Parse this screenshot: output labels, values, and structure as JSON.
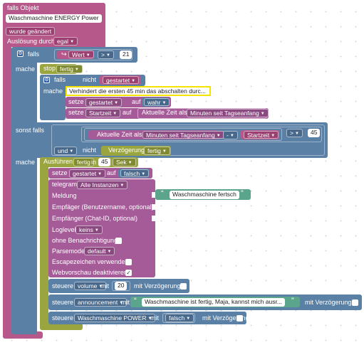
{
  "colors": {
    "event": "#b6598a",
    "logic": "#5b80a5",
    "timeout": "#9aa53f",
    "action": "#a55b98",
    "text": "#5ba58c",
    "comment_border": "#f5e400"
  },
  "trigger": {
    "title": "falls Objekt",
    "object": "Waschmaschine ENERGY Power",
    "condition": "wurde geändert",
    "ack_label": "Auslösung durch",
    "ack_value": "egal"
  },
  "if_outer": {
    "falls": "falls",
    "mache": "mache",
    "sonst_falls": "sonst falls",
    "mache2": "mache",
    "cond": {
      "fn_icon": "↪",
      "fn_value": "Wert",
      "op": ">",
      "num": "21"
    }
  },
  "stop": {
    "label": "stop",
    "value": "fertig"
  },
  "if_inner": {
    "falls": "falls",
    "not": "nicht",
    "var": "gestartet",
    "mache": "mache",
    "comment": "Verhindert die ersten 45 min das abschalten durc...",
    "set1": {
      "setze": "setze",
      "var": "gestartet",
      "auf": "auf",
      "value": "wahr"
    },
    "set2": {
      "setze": "setze",
      "var": "Startzeit",
      "auf": "auf",
      "time_label": "Aktuelle Zeit als",
      "time_format": "Minuten seit Tagseanfang"
    }
  },
  "elseif_cond": {
    "time_label": "Aktuelle Zeit als",
    "time_format": "Minuten seit Tagseanfang",
    "minus": "-",
    "var": "Startzeit",
    "op": ">",
    "num": "45",
    "and": "und",
    "not": "nicht",
    "timeout_label": "Verzögerung",
    "timeout_value": "fertig"
  },
  "timeout": {
    "label": "Ausführen",
    "name": "fertig",
    "in": "in",
    "delay": "45",
    "unit": "Sek"
  },
  "set3": {
    "setze": "setze",
    "var": "gestartet",
    "auf": "auf",
    "value": "falsch"
  },
  "telegram": {
    "label": "telegram",
    "instance": "Alle Instanzen",
    "meldung": "Meldung",
    "message": "Waschmaschine fertsch",
    "empfaenger_name": "Empfäger (Benutzername, optional)",
    "empfaenger_chat": "Empfänger (Chat-ID, optional)",
    "loglevel_label": "Loglevel",
    "loglevel_value": "keins",
    "no_notification": "ohne Benachrichtigung",
    "parsemode_label": "Parsemode",
    "parsemode_value": "default",
    "escape": "Escapezeichen verwenden",
    "webpreview": "Webvorschau deaktivieren",
    "webpreview_check": "✓"
  },
  "control1": {
    "steuere": "steuere",
    "target": "volume",
    "mit": "mit",
    "value": "20",
    "delay": "mit Verzögerung"
  },
  "control2": {
    "steuere": "steuere",
    "target": "announcement",
    "mit": "mit",
    "value": "Waschmaschine ist fertig, Maja, kannst mich ausr...",
    "delay": "mit Verzögerung"
  },
  "control3": {
    "steuere": "steuere",
    "target": "Waschmaschine POWER",
    "mit": "mit",
    "value": "falsch",
    "delay": "mit Verzögerung"
  },
  "quotes": {
    "open": "“",
    "close": "”"
  }
}
